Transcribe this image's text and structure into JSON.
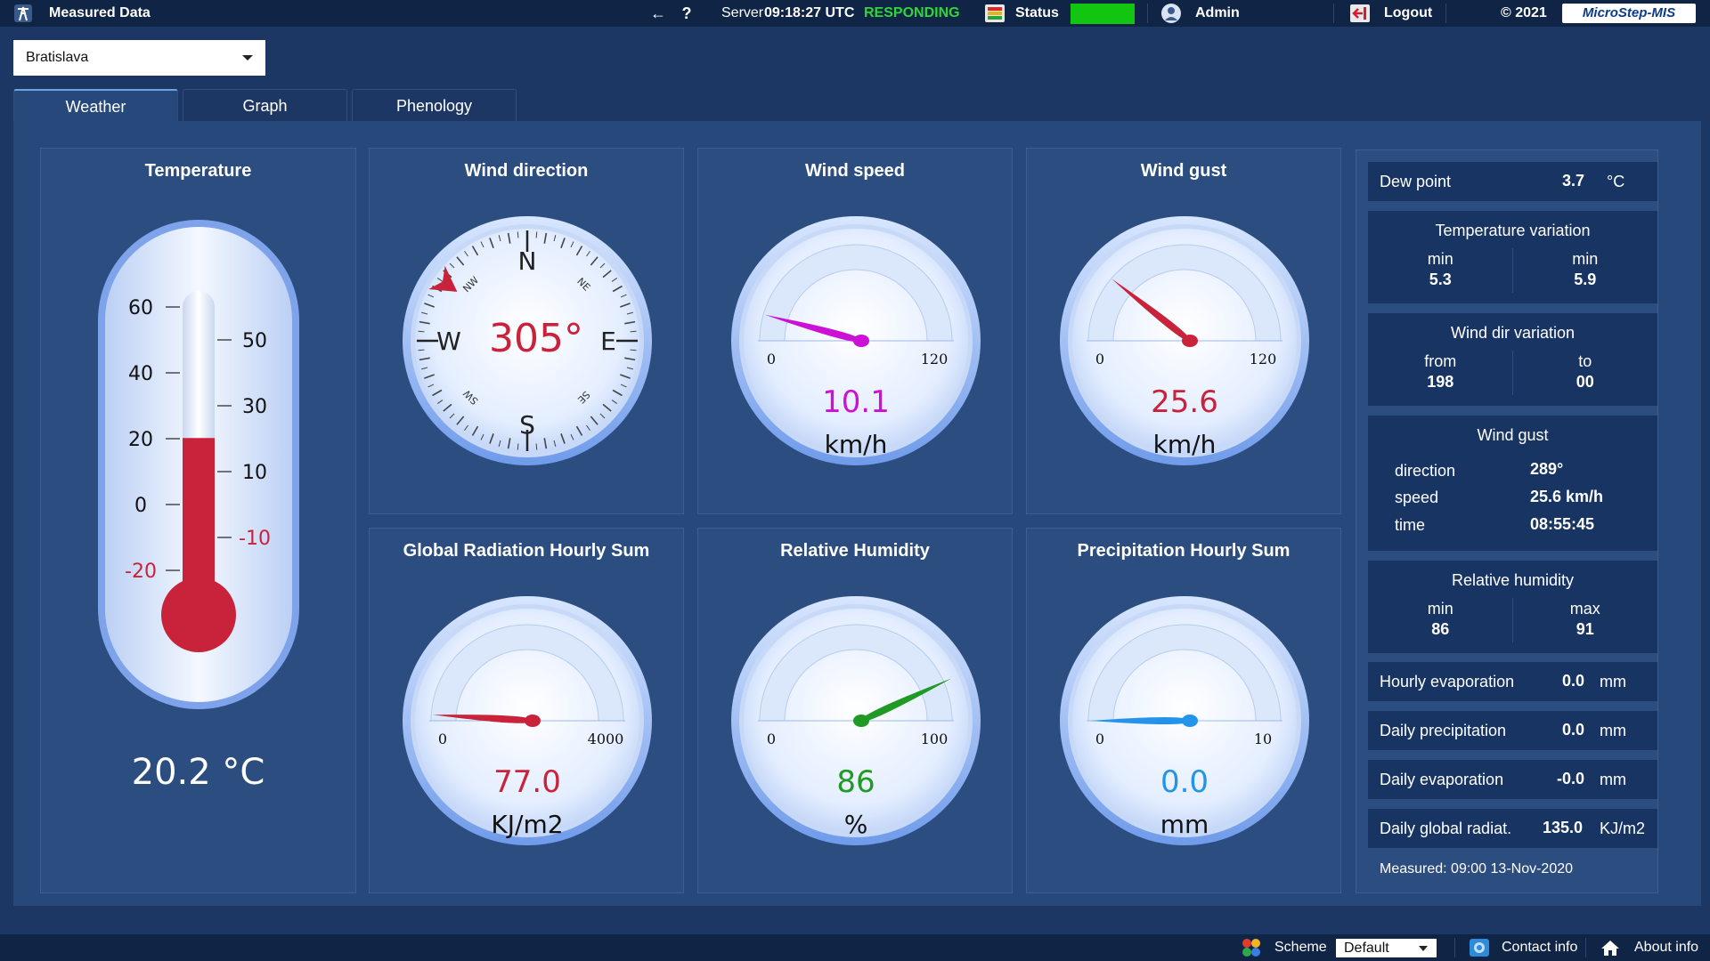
{
  "topbar": {
    "app_title": "Measured Data",
    "nav_back": "←",
    "nav_help": "?",
    "server_label": "Server",
    "server_time": "09:18:27 UTC",
    "server_state": "RESPONDING",
    "status_label": "Status",
    "status_color": "#11c511",
    "user": "Admin",
    "logout": "Logout",
    "copyright": "© 2021",
    "logo": "MicroStep-MIS"
  },
  "station": {
    "selected": "Bratislava"
  },
  "tabs": [
    {
      "label": "Weather",
      "active": true
    },
    {
      "label": "Graph",
      "active": false
    },
    {
      "label": "Phenology",
      "active": false
    }
  ],
  "temperature": {
    "title": "Temperature",
    "celsius_ticks": [
      "60",
      "40",
      "20",
      "0",
      "-20"
    ],
    "right_ticks": [
      "50",
      "30",
      "10",
      "-10"
    ],
    "fill_value": 20.2,
    "readout": "20.2 °C"
  },
  "wind_direction": {
    "title": "Wind direction",
    "value_deg": 305,
    "readout": "305°",
    "cardinals": {
      "n": "N",
      "e": "E",
      "s": "S",
      "w": "W"
    },
    "intercardinals": {
      "ne": "NE",
      "se": "SE",
      "sw": "SW",
      "nw": "NW"
    },
    "needle_color": "#c8233a"
  },
  "wind_speed": {
    "title": "Wind speed",
    "min": "0",
    "max": "120",
    "value": 10.1,
    "readout": "10.1",
    "unit": "km/h",
    "color": "#cc10d6"
  },
  "wind_gust": {
    "title": "Wind gust",
    "min": "0",
    "max": "120",
    "value": 25.6,
    "readout": "25.6",
    "unit": "km/h",
    "color": "#c8233a"
  },
  "radiation": {
    "title": "Global Radiation Hourly Sum",
    "min": "0",
    "max": "4000",
    "value": 77.0,
    "readout": "77.0",
    "unit": "KJ/m2",
    "color": "#c8233a"
  },
  "humidity": {
    "title": "Relative Humidity",
    "min": "0",
    "max": "100",
    "value": 86,
    "readout": "86",
    "unit": "%",
    "color": "#1f9a24"
  },
  "precipitation": {
    "title": "Precipitation Hourly Sum",
    "min": "0",
    "max": "10",
    "value": 0.0,
    "readout": "0.0",
    "unit": "mm",
    "color": "#2493ea"
  },
  "info": {
    "dew_point": {
      "label": "Dew point",
      "value": "3.7",
      "unit": "°C"
    },
    "temp_variation": {
      "title": "Temperature variation",
      "left_label": "min",
      "left_value": "5.3",
      "right_label": "min",
      "right_value": "5.9"
    },
    "wind_dir_variation": {
      "title": "Wind dir variation",
      "left_label": "from",
      "left_value": "198",
      "right_label": "to",
      "right_value": "00"
    },
    "wind_gust": {
      "title": "Wind gust",
      "direction_label": "direction",
      "direction_value": "289°",
      "speed_label": "speed",
      "speed_value": "25.6 km/h",
      "time_label": "time",
      "time_value": "08:55:45"
    },
    "rel_humidity": {
      "title": "Relative humidity",
      "left_label": "min",
      "left_value": "86",
      "right_label": "max",
      "right_value": "91"
    },
    "hourly_evaporation": {
      "label": "Hourly evaporation",
      "value": "0.0",
      "unit": "mm"
    },
    "daily_precipitation": {
      "label": "Daily precipitation",
      "value": "0.0",
      "unit": "mm"
    },
    "daily_evaporation": {
      "label": "Daily evaporation",
      "value": "-0.0",
      "unit": "mm"
    },
    "daily_radiation": {
      "label": "Daily global radiat.",
      "value": "135.0",
      "unit": "KJ/m2"
    },
    "measured": "Measured: 09:00 13-Nov-2020"
  },
  "bottombar": {
    "scheme_label": "Scheme",
    "scheme_value": "Default",
    "contact": "Contact info",
    "about": "About info"
  }
}
